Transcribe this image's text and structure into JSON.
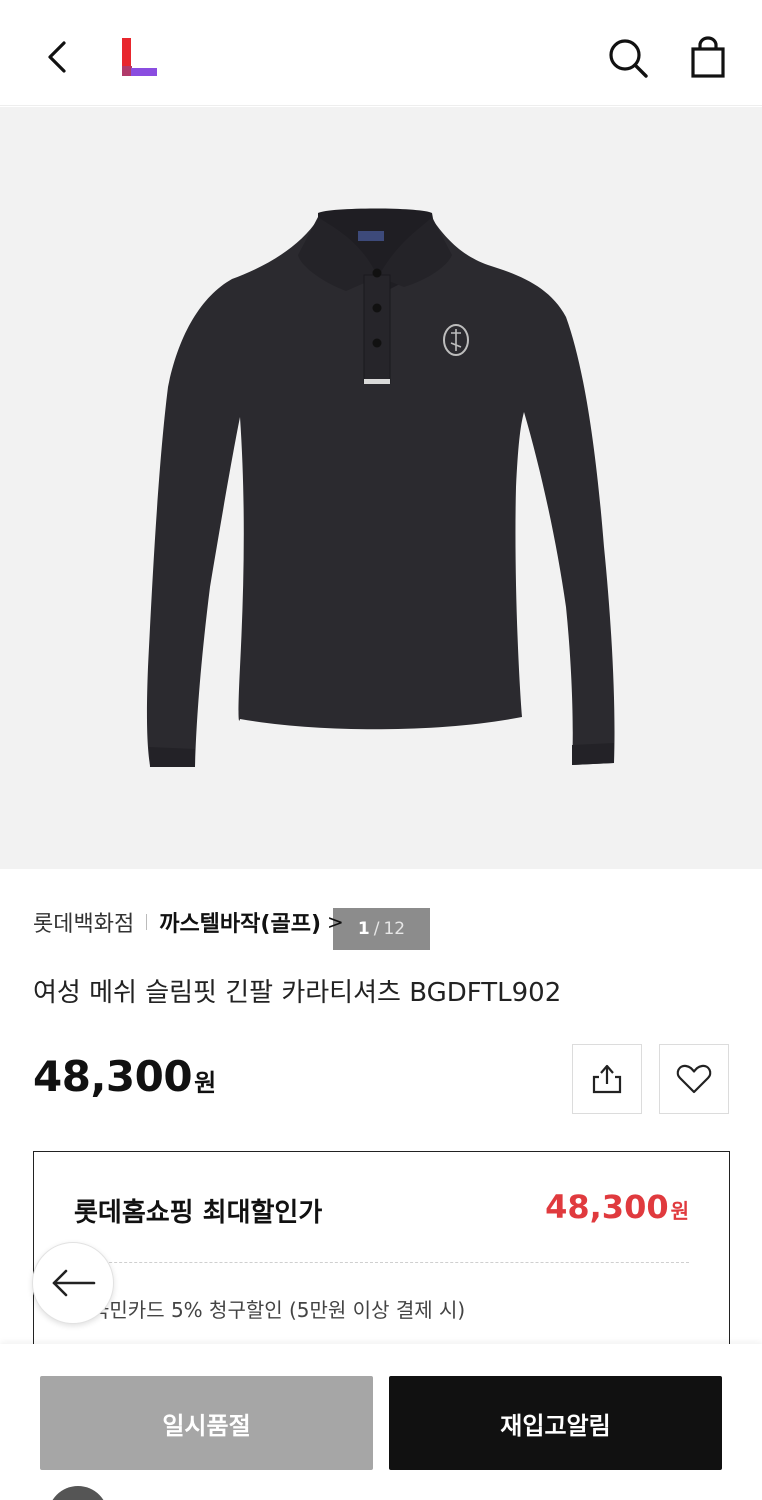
{
  "header": {
    "back_icon": "chevron-left-icon",
    "logo_icon": "lotte-l-logo",
    "search_icon": "search-icon",
    "cart_icon": "shopping-bag-icon"
  },
  "gallery": {
    "current": "1",
    "separator": "/",
    "total": "12"
  },
  "product": {
    "store": "롯데백화점",
    "brand": "까스텔바작(골프)",
    "brand_arrow": ">",
    "title": "여성 메쉬 슬림핏 긴팔 카라티셔츠 BGDFTL902",
    "price": "48,300",
    "price_unit": "원"
  },
  "actions": {
    "share_icon": "share-icon",
    "wish_icon": "heart-icon"
  },
  "discount": {
    "label": "롯데홈쇼핑 최대할인가",
    "price": "48,300",
    "price_unit": "원",
    "benefit": "국민카드 5% 청구할인 (5만원 이상 결제 시)"
  },
  "bottom": {
    "soldout_label": "일시품절",
    "restock_label": "재입고알림"
  },
  "colors": {
    "accent_red": "#e03a3e",
    "logo_red": "#e8262d",
    "logo_purple": "#8a4de0",
    "soldout_gray": "#a6a6a6",
    "restock_black": "#111111"
  }
}
